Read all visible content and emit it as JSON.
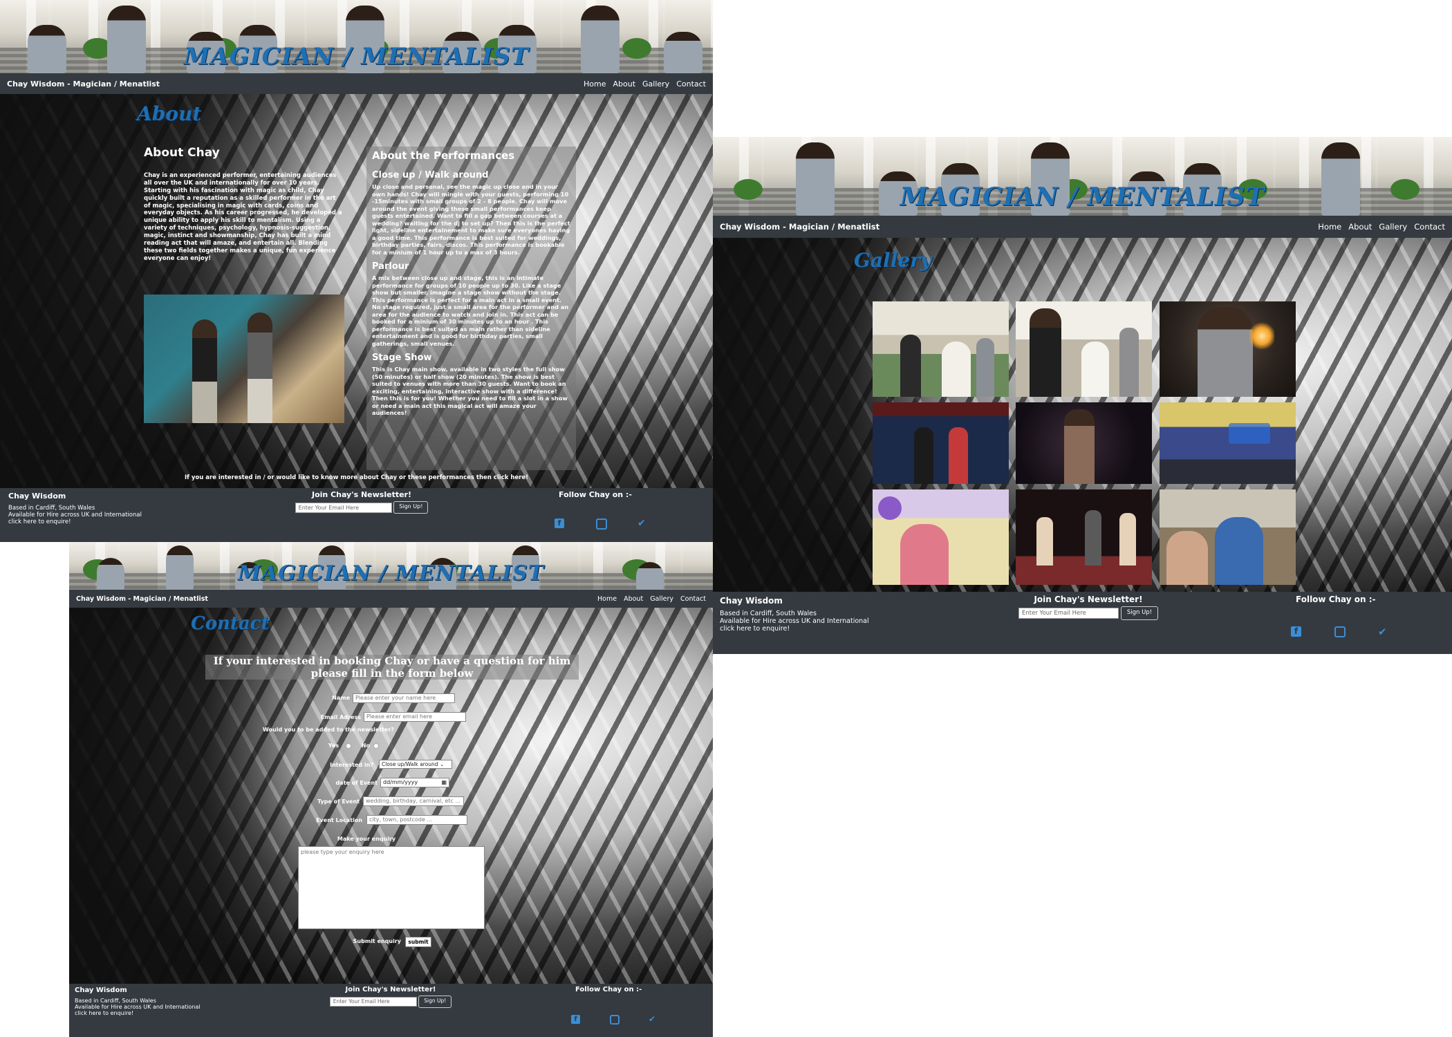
{
  "site": {
    "banner_title": "MAGICIAN / MENTALIST",
    "brand": "Chay Wisdom - Magician / Menatlist",
    "nav": [
      "Home",
      "About",
      "Gallery",
      "Contact"
    ]
  },
  "about_page": {
    "heading": "About",
    "about_chay": {
      "title": "About Chay",
      "body": "Chay is an experienced performer, entertaining audiences all over the UK and internationally for over 10 years. Starting with his fascination with magic as child, Chay quickly built a reputation as a skilled performer in the art of magic, specialising in magic with cards, coins and everyday objects. As his career progressed, he developed a unique ability to apply his skill to mentalism. Using a variety of techniques, psychology, hypnosis-suggestion, magic, instinct and showmanship, Chay has built a mind reading act that will amaze, and entertain all. Blending these two fields together makes a unique, fun experience everyone can enjoy!"
    },
    "performances": {
      "title": "About the Performances",
      "items": [
        {
          "title": "Close up / Walk around",
          "body": "Up close and personal, see the magic up close and in your own hands! Chay will mingle with your guests, performing 10 -15minutes with small groups of 2 - 8 people. Chay will move around the event giving these small performances keep guests entertained. Want to fill a gap between courses at a wedding? waiting for the dj to set up? Then this is the perfect light, sideline entertainement to make sure everyones having a good time. This performance is best suited for weddings, birthday parties, fairs, discos. This performance is bookable for a minium of 1 hour up to a max of 3 hours."
        },
        {
          "title": "Parlour",
          "body": "A mix between close up and stage, this is an intimate performance for groups of 10 people up to 30. Like a stage show but smaller, imagine a stage show without the stage. This performance is perfect for a main act in a small event. No stage required, just a small area for the performer and an area for the audience to watch and join in. This act can be booked for a minium of 30 minutes up to an hour . This performance is best suited as main rather than sideline entertainment and is good for birthday parties, small gatherings, small venues."
        },
        {
          "title": "Stage Show",
          "body": "This is Chay main show, available in two styles the full show (50 minutes) or half show (20 minutes). The show is best suited to venues with more than 30 guests. Want to book an exciting, entertaining, interactive show with a difference! Then this is for you! Whether you need to fill a slot in a show or need a main act this magical act will amaze your audiences!"
        }
      ]
    },
    "cta": "If you are interested in / or would like to know more about Chay or these performances then click here!"
  },
  "gallery_page": {
    "heading": "Gallery"
  },
  "contact_page": {
    "heading": "Contact",
    "banner": "If your interested in booking Chay or have a question for him please fill in the form below",
    "name_label": "Name",
    "name_placeholder": "Please enter your name here",
    "email_label": "Email Adress",
    "email_placeholder": "Please enter email here",
    "newsletter_question": "Would you to be added to the newsletter?",
    "yes_label": "Yes",
    "no_label": "No",
    "interested_label": "Interested in?",
    "interested_value": "Close up/Walk around",
    "date_label": "date of Event",
    "date_value": "dd/mm/yyyy",
    "type_label": "Type of Event",
    "type_placeholder": "wedding, birthday, carnival, etc ...",
    "location_label": "Event Location",
    "location_placeholder": "city, town, postcode ...",
    "enquiry_label": "Make your enquiry",
    "enquiry_placeholder": "please type your enquiry here",
    "submit_label": "Submit enquiry",
    "submit_button": "submit"
  },
  "footer": {
    "name": "Chay Wisdom",
    "location": "Based in Cardiff, South Wales",
    "availability": "Available for Hire across UK and International",
    "enquire": "click here to enquire!",
    "newsletter_title": "Join Chay's Newsletter!",
    "newsletter_placeholder": "Enter Your Email Here",
    "newsletter_button": "Sign Up!",
    "follow": "Follow Chay on :-",
    "social_icons": [
      "facebook-icon",
      "instagram-icon",
      "twitter-icon"
    ]
  },
  "colors": {
    "nav_bg": "#343a40",
    "heading_blue": "#1e6fb3",
    "social_blue": "#3b8ed6"
  }
}
